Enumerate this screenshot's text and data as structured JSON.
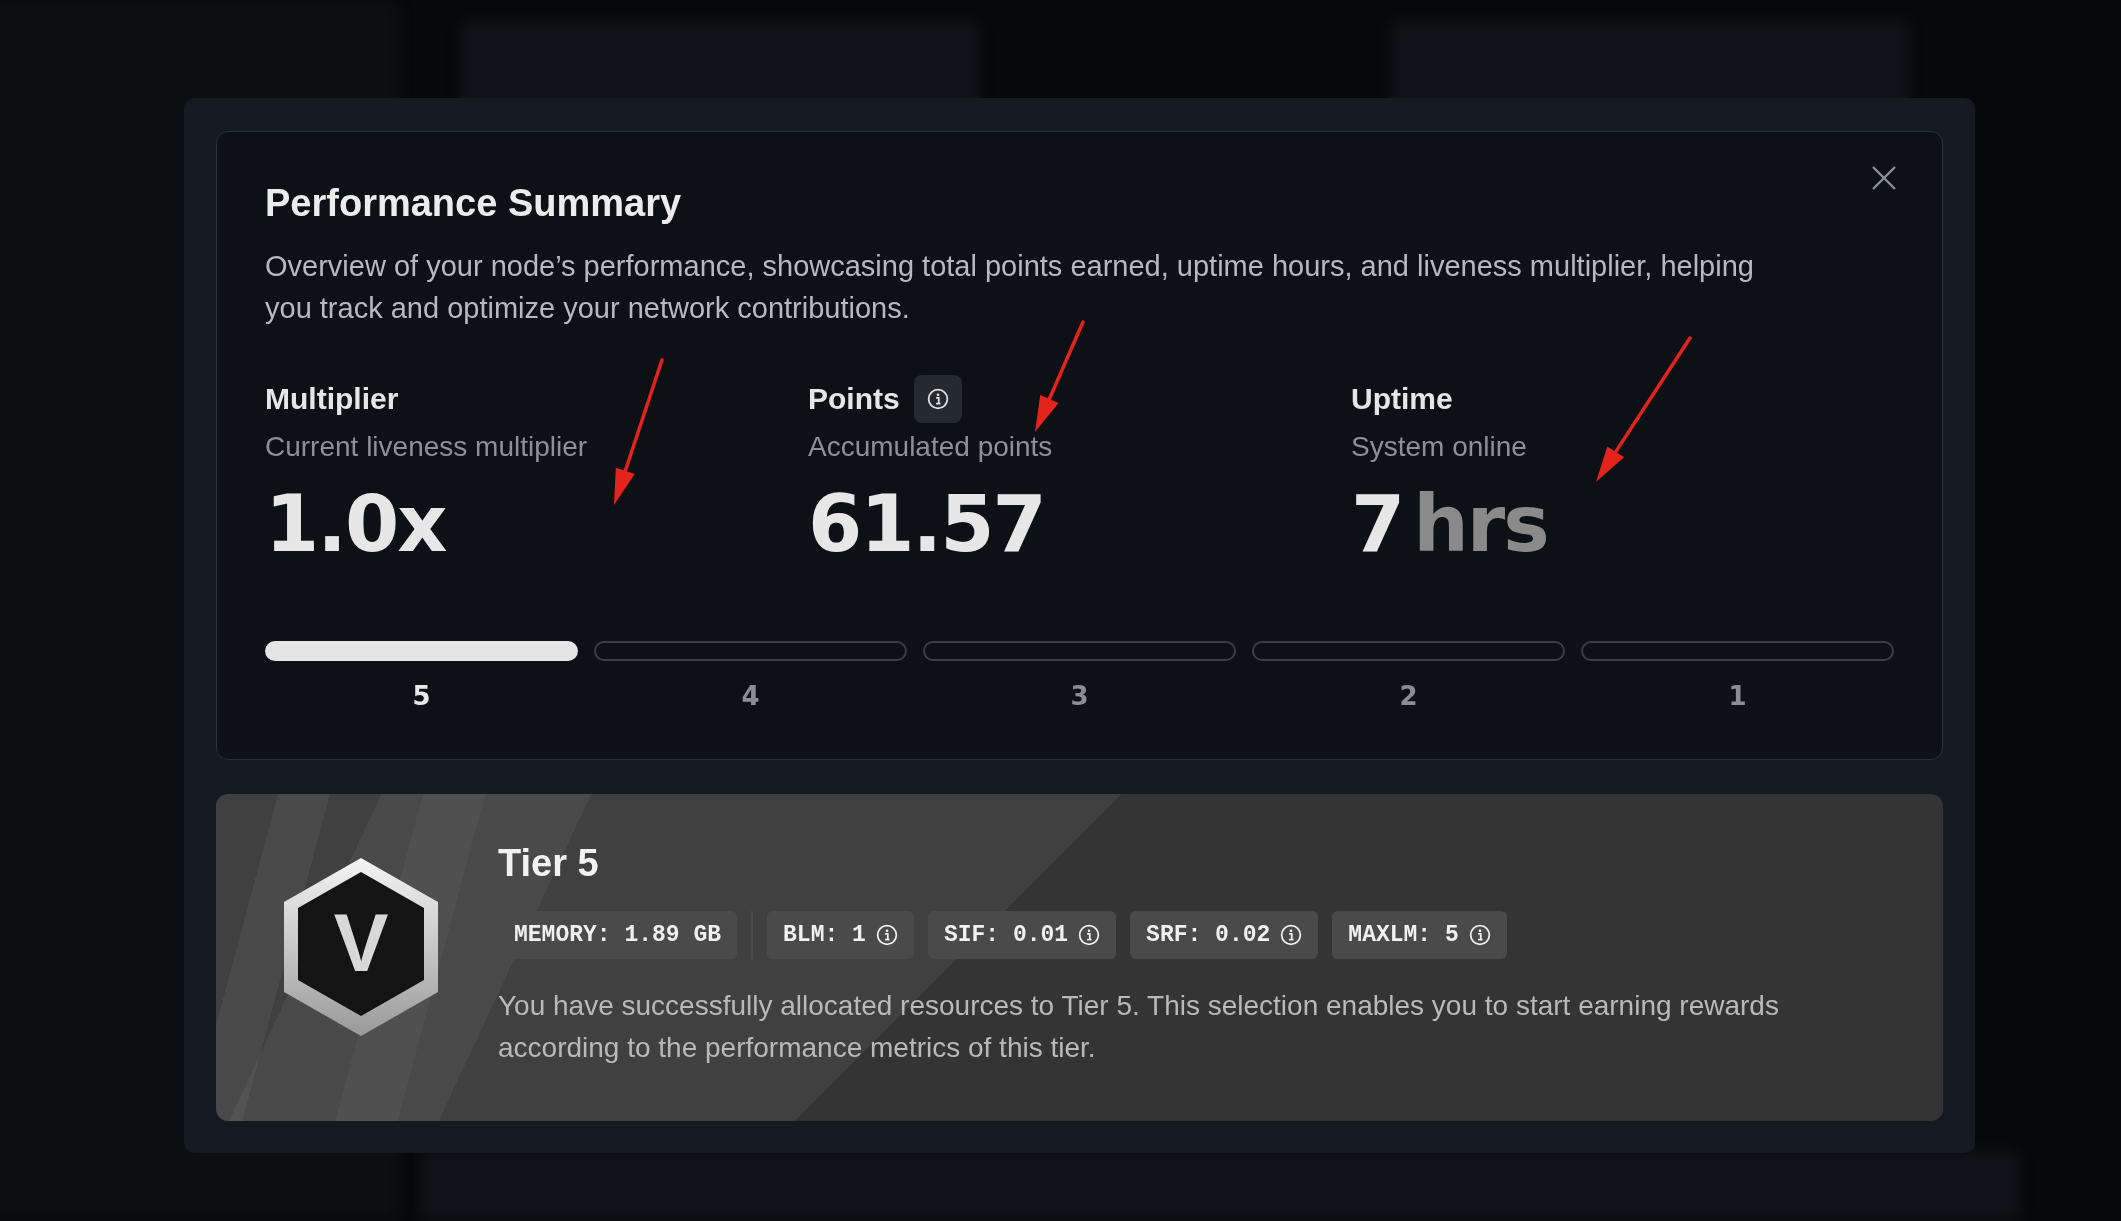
{
  "dialog": {
    "title": "Performance Summary",
    "description": "Overview of your node’s performance, showcasing total points earned, uptime hours, and liveness multiplier, helping you track and optimize your network contributions.",
    "stats": [
      {
        "title": "Multiplier",
        "info": false,
        "subtitle": "Current liveness multiplier",
        "value": "1.0x"
      },
      {
        "title": "Points",
        "info": true,
        "subtitle": "Accumulated points",
        "value": "61.57"
      },
      {
        "title": "Uptime",
        "info": false,
        "subtitle": "System online",
        "value": "7",
        "unit": "hrs"
      }
    ],
    "tiers": [
      {
        "label": "5",
        "filled": true
      },
      {
        "label": "4",
        "filled": false
      },
      {
        "label": "3",
        "filled": false
      },
      {
        "label": "2",
        "filled": false
      },
      {
        "label": "1",
        "filled": false
      }
    ],
    "tier_card": {
      "badge_letter": "V",
      "title": "Tier 5",
      "chips": [
        {
          "text": "MEMORY: 1.89 GB",
          "info": false
        },
        {
          "text": "BLM: 1",
          "info": true
        },
        {
          "text": "SIF: 0.01",
          "info": true
        },
        {
          "text": "SRF: 0.02",
          "info": true
        },
        {
          "text": "MAXLM: 5",
          "info": true
        }
      ],
      "description": "You have successfully allocated resources to Tier 5. This selection enables you to start earning rewards according to the performance metrics of this tier."
    }
  }
}
